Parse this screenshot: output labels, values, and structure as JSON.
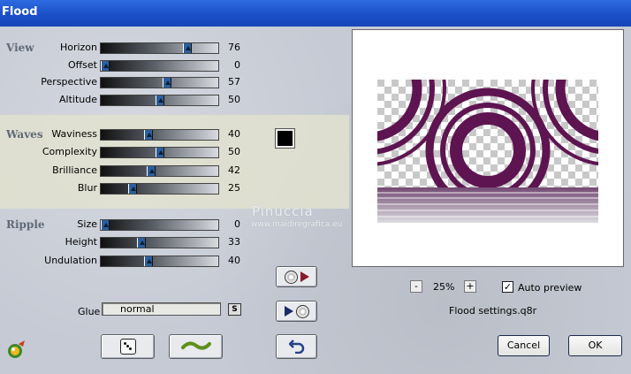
{
  "window": {
    "title": "Flood"
  },
  "groups": {
    "view": "View",
    "waves": "Waves",
    "ripple": "Ripple"
  },
  "sliders": [
    {
      "label": "Horizon",
      "value": "76",
      "fraction": 0.76
    },
    {
      "label": "Offset",
      "value": "0",
      "fraction": 0.0
    },
    {
      "label": "Perspective",
      "value": "57",
      "fraction": 0.57
    },
    {
      "label": "Altitude",
      "value": "50",
      "fraction": 0.5
    },
    {
      "label": "Waviness",
      "value": "40",
      "fraction": 0.4
    },
    {
      "label": "Complexity",
      "value": "50",
      "fraction": 0.5
    },
    {
      "label": "Brilliance",
      "value": "42",
      "fraction": 0.42
    },
    {
      "label": "Blur",
      "value": "25",
      "fraction": 0.25
    },
    {
      "label": "Size",
      "value": "0",
      "fraction": 0.0
    },
    {
      "label": "Height",
      "value": "33",
      "fraction": 0.33
    },
    {
      "label": "Undulation",
      "value": "40",
      "fraction": 0.4
    }
  ],
  "color": {
    "swatch": "#000000"
  },
  "glue": {
    "label": "Glue",
    "value": "normal",
    "button": "S"
  },
  "watermark": {
    "line1": "Pinuccia",
    "line2": "www.maidiregrafica.eu"
  },
  "zoom": {
    "minus": "-",
    "value": "25%",
    "plus": "+"
  },
  "auto_preview": {
    "label": "Auto preview",
    "checked": true,
    "mark": "✓"
  },
  "settings_file": "Flood settings.q8r",
  "buttons": {
    "cancel": "Cancel",
    "ok": "OK"
  }
}
